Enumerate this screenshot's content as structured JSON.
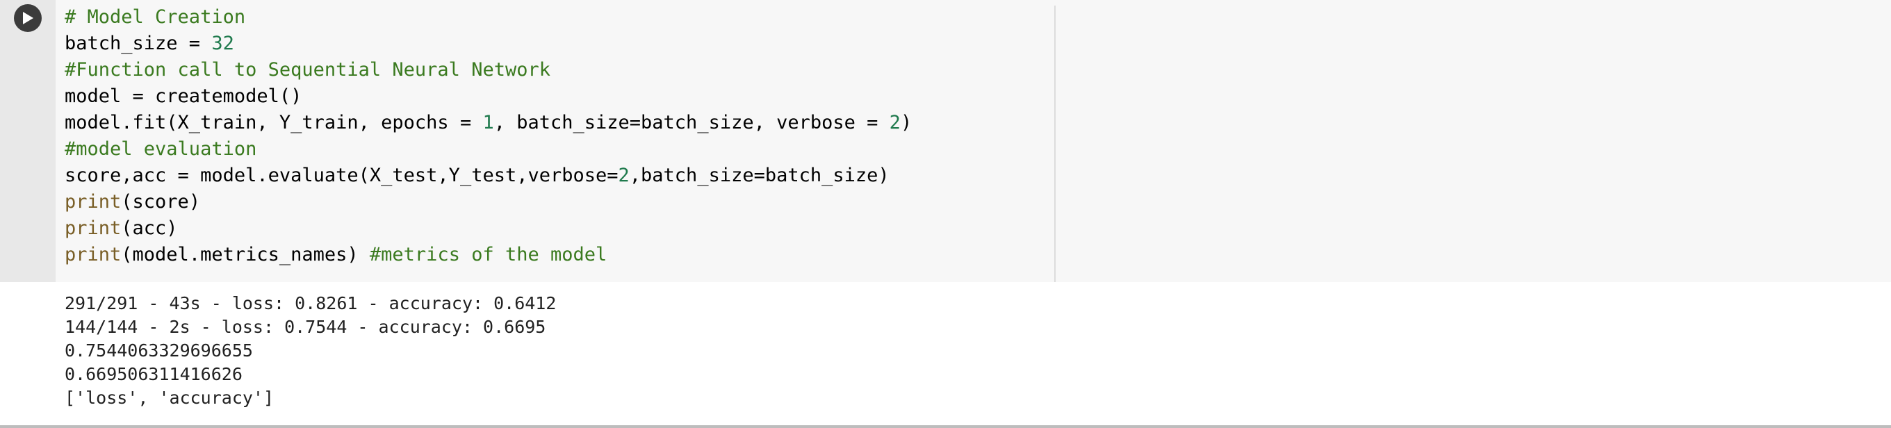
{
  "cell": {
    "run_button_icon": "play-icon",
    "code_lines": [
      [
        {
          "t": "# Model Creation",
          "k": "comment"
        }
      ],
      [
        {
          "t": "batch_size = ",
          "k": "plain"
        },
        {
          "t": "32",
          "k": "num"
        }
      ],
      [
        {
          "t": "#Function call to Sequential Neural Network",
          "k": "comment"
        }
      ],
      [
        {
          "t": "model = createmodel()",
          "k": "plain"
        }
      ],
      [
        {
          "t": "model.fit(X_train, Y_train, epochs = ",
          "k": "plain"
        },
        {
          "t": "1",
          "k": "num"
        },
        {
          "t": ", batch_size=batch_size, verbose = ",
          "k": "plain"
        },
        {
          "t": "2",
          "k": "num"
        },
        {
          "t": ")",
          "k": "plain"
        }
      ],
      [
        {
          "t": "#model evaluation",
          "k": "comment"
        }
      ],
      [
        {
          "t": "score,acc = model.evaluate(X_test,Y_test,verbose=",
          "k": "plain"
        },
        {
          "t": "2",
          "k": "num"
        },
        {
          "t": ",batch_size=batch_size)",
          "k": "plain"
        }
      ],
      [
        {
          "t": "print",
          "k": "fn"
        },
        {
          "t": "(score)",
          "k": "plain"
        }
      ],
      [
        {
          "t": "print",
          "k": "fn"
        },
        {
          "t": "(acc)",
          "k": "plain"
        }
      ],
      [
        {
          "t": "print",
          "k": "fn"
        },
        {
          "t": "(model.metrics_names) ",
          "k": "plain"
        },
        {
          "t": "#metrics of the model",
          "k": "comment"
        }
      ]
    ]
  },
  "output": {
    "lines": [
      "291/291 - 43s - loss: 0.8261 - accuracy: 0.6412",
      "144/144 - 2s - loss: 0.7544 - accuracy: 0.6695",
      "0.7544063329696655",
      "0.669506311416626",
      "['loss', 'accuracy']"
    ]
  },
  "colors": {
    "comment": "#3a7a1f",
    "number": "#1f7a4d",
    "builtin_fn": "#795e26",
    "editor_bg": "#f7f7f7",
    "gutter_bg": "#e8e8e8"
  }
}
